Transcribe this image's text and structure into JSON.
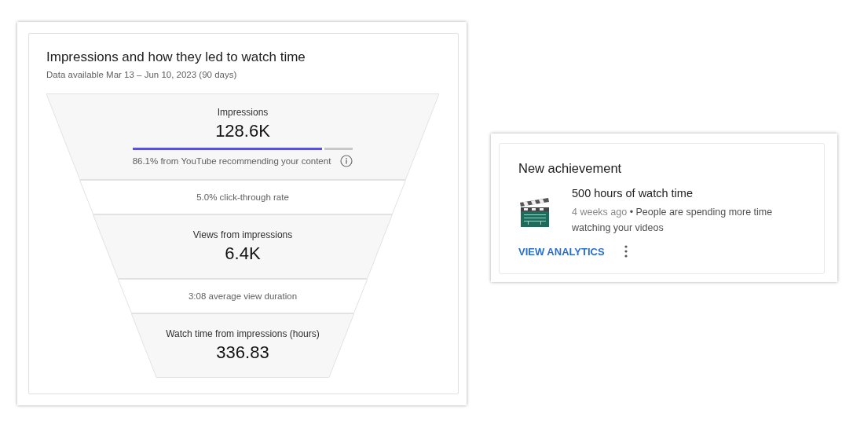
{
  "impressions_card": {
    "title": "Impressions and how they led to watch time",
    "subtitle": "Data available Mar 13 – Jun 10, 2023 (90 days)",
    "funnel": [
      {
        "kind": "metric",
        "label": "Impressions",
        "value": "128.6K",
        "level": 0.861,
        "note": "86.1% from YouTube recommending your content"
      },
      {
        "kind": "rate",
        "text": "5.0% click-through rate"
      },
      {
        "kind": "metric",
        "label": "Views from impressions",
        "value": "6.4K"
      },
      {
        "kind": "rate",
        "text": "3:08 average view duration"
      },
      {
        "kind": "metric",
        "label": "Watch time from impressions (hours)",
        "value": "336.83"
      }
    ]
  },
  "achievement_card": {
    "title": "New achievement",
    "headline": "500 hours of watch time",
    "time": "4 weeks ago",
    "bullet": "•",
    "description": "People are spending more time watching your videos",
    "action": "VIEW ANALYTICS"
  }
}
